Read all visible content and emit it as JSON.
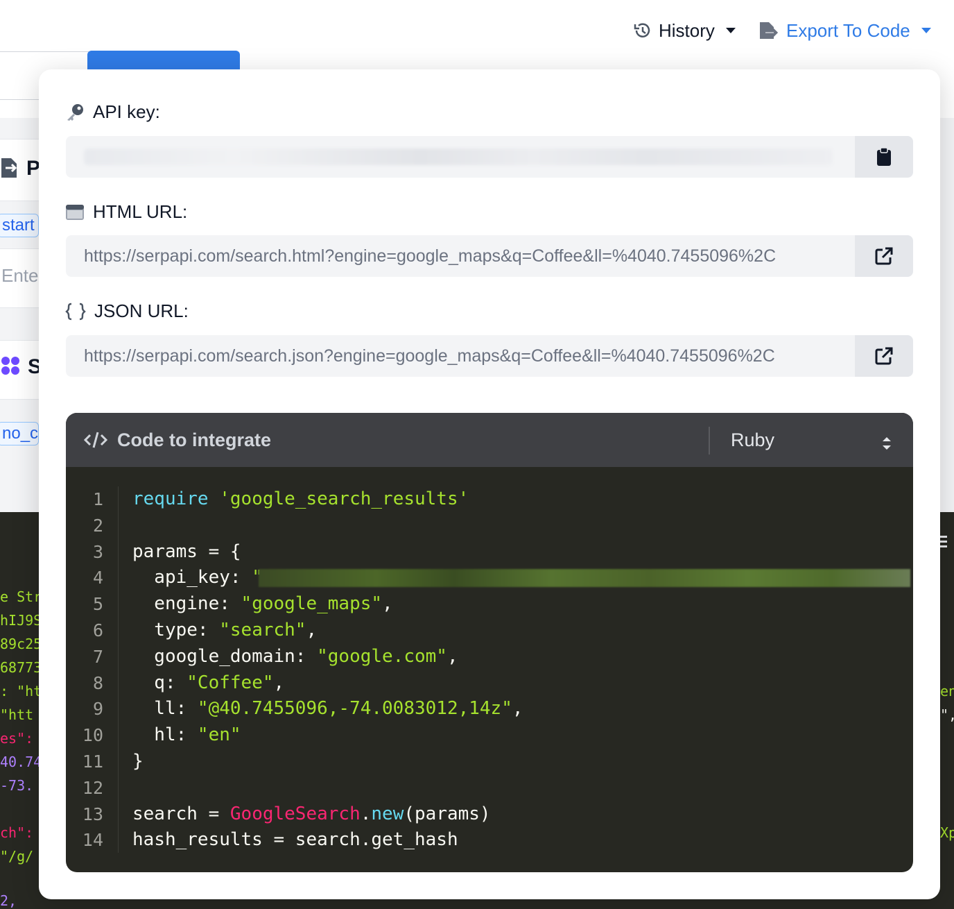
{
  "topbar": {
    "history_label": "History",
    "export_label": "Export To Code"
  },
  "background": {
    "side_heading_1": "P",
    "side_heading_2": "S",
    "chip_start": "start",
    "input_placeholder": "Ente",
    "chip_no_cache": "no_ca",
    "code_fragments": [
      "e Str",
      "hIJ9S",
      "89c25",
      "68773",
      ": \"ht",
      " \"htt",
      "es\":",
      "40.74",
      " -73.",
      "ch\":",
      " \"/g/",
      "2,"
    ],
    "code_fragments_right": [
      "en",
      "\",",
      "Xp"
    ]
  },
  "popover": {
    "api_key": {
      "label": "API key:",
      "value": ""
    },
    "html_url": {
      "label": "HTML URL:",
      "value": "https://serpapi.com/search.html?engine=google_maps&q=Coffee&ll=%4040.7455096%2C"
    },
    "json_url": {
      "label": "JSON URL:",
      "value": "https://serpapi.com/search.json?engine=google_maps&q=Coffee&ll=%4040.7455096%2C"
    },
    "code": {
      "title": "Code to integrate",
      "language": "Ruby",
      "line_numbers": [
        "1",
        "2",
        "3",
        "4",
        "5",
        "6",
        "7",
        "8",
        "9",
        "10",
        "11",
        "12",
        "13",
        "14"
      ],
      "lines": {
        "l1_kw": "require",
        "l1_str": "'google_search_results'",
        "l3": "params = {",
        "l4_key": "  api_key: ",
        "l4_str": "\"",
        "l5_key": "  engine: ",
        "l5_str": "\"google_maps\"",
        "l6_key": "  type: ",
        "l6_str": "\"search\"",
        "l7_key": "  google_domain: ",
        "l7_str": "\"google.com\"",
        "l8_key": "  q: ",
        "l8_str": "\"Coffee\"",
        "l9_key": "  ll: ",
        "l9_str": "\"@40.7455096,-74.0083012,14z\"",
        "l10_key": "  hl: ",
        "l10_str": "\"en\"",
        "l11": "}",
        "l13_a": "search = ",
        "l13_cls": "GoogleSearch",
        "l13_dot": ".",
        "l13_method": "new",
        "l13_b": "(params)",
        "l14": "hash_results = search.get_hash",
        "comma": ","
      }
    }
  }
}
